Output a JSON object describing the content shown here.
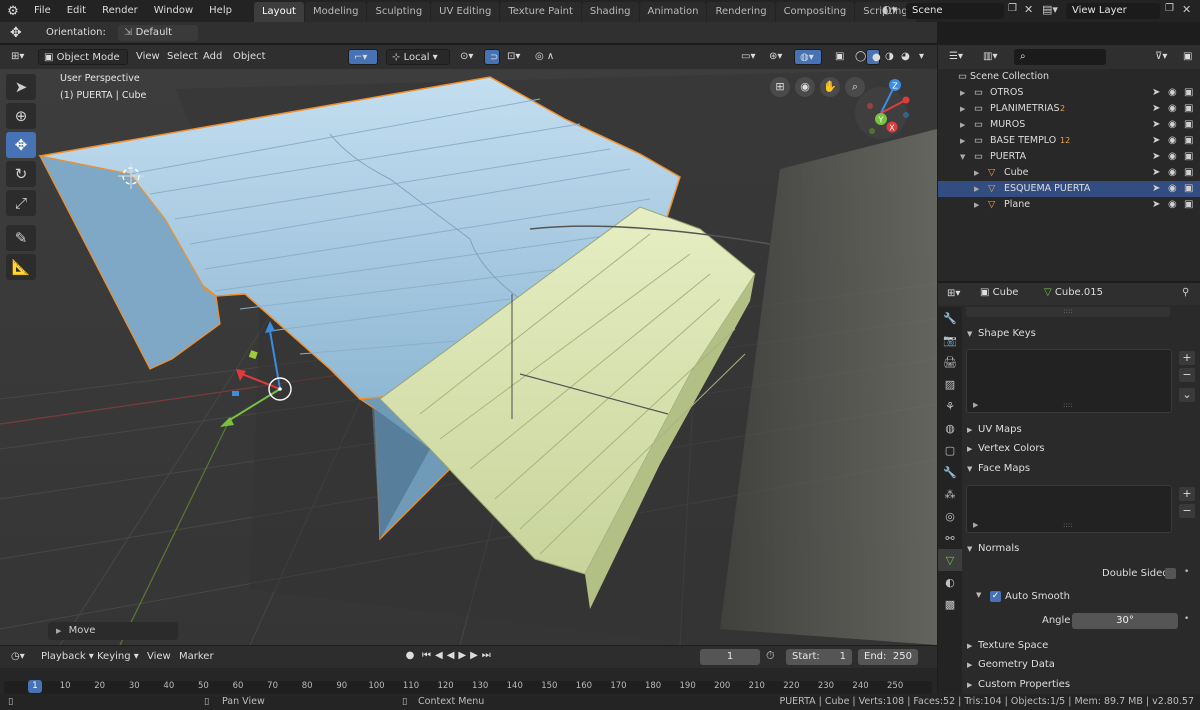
{
  "topbar": {
    "menus": [
      "File",
      "Edit",
      "Render",
      "Window",
      "Help"
    ],
    "workspaces": [
      "Layout",
      "Modeling",
      "Sculpting",
      "UV Editing",
      "Texture Paint",
      "Shading",
      "Animation",
      "Rendering",
      "Compositing",
      "Scripting"
    ],
    "active_workspace": "Layout",
    "add_tab": "+",
    "scene_label": "Scene",
    "view_layer_label": "View Layer"
  },
  "tool_header": {
    "orientation_label": "Orientation:",
    "orientation_value": "Default"
  },
  "viewport_header": {
    "mode": "Object Mode",
    "menus": [
      "View",
      "Select",
      "Add",
      "Object"
    ],
    "transform_orientation": "Local"
  },
  "viewport": {
    "perspective_label": "User Perspective",
    "object_label": "(1) PUERTA | Cube",
    "last_operator": "Move",
    "gizmo_axes": {
      "x": "X",
      "y": "Y",
      "z": "Z"
    }
  },
  "colors": {
    "accent": "#4772b3",
    "selection": "#334d80",
    "mesh_blue": "#a9cde3",
    "mesh_green": "#d9e3b3",
    "outline_orange": "#f0902a"
  },
  "timeline": {
    "menus": [
      "Playback",
      "Keying",
      "View",
      "Marker"
    ],
    "current_frame": "1",
    "start_label": "Start:",
    "start_value": "1",
    "end_label": "End:",
    "end_value": "250",
    "ticks": [
      "1",
      "10",
      "20",
      "30",
      "40",
      "50",
      "60",
      "70",
      "80",
      "90",
      "100",
      "110",
      "120",
      "130",
      "140",
      "150",
      "160",
      "170",
      "180",
      "190",
      "200",
      "210",
      "220",
      "230",
      "240",
      "250"
    ]
  },
  "outliner": {
    "root": "Scene Collection",
    "items": [
      {
        "label": "OTROS",
        "indent": 1
      },
      {
        "label": "PLANIMETRIAS",
        "indent": 1,
        "badge": "2"
      },
      {
        "label": "MUROS",
        "indent": 1
      },
      {
        "label": "BASE TEMPLO",
        "indent": 1,
        "badge": "12"
      },
      {
        "label": "PUERTA",
        "indent": 1
      },
      {
        "label": "Cube",
        "indent": 2
      },
      {
        "label": "ESQUEMA PUERTA",
        "indent": 2,
        "selected": true
      },
      {
        "label": "Plane",
        "indent": 2
      }
    ]
  },
  "properties": {
    "object_name": "Cube",
    "mesh_name": "Cube.015",
    "panels": {
      "shape_keys": "Shape Keys",
      "uv_maps": "UV Maps",
      "vertex_colors": "Vertex Colors",
      "face_maps": "Face Maps",
      "normals": "Normals",
      "double_sided": "Double Sided",
      "auto_smooth": "Auto Smooth",
      "angle_label": "Angle",
      "angle_value": "30°",
      "texture_space": "Texture Space",
      "geometry_data": "Geometry Data",
      "custom_properties": "Custom Properties"
    }
  },
  "status": {
    "pan_view": "Pan View",
    "context_menu": "Context Menu",
    "stats": "PUERTA | Cube | Verts:108 | Faces:52 | Tris:104 | Objects:1/5 | Mem: 89.7 MB | v2.80.57"
  }
}
